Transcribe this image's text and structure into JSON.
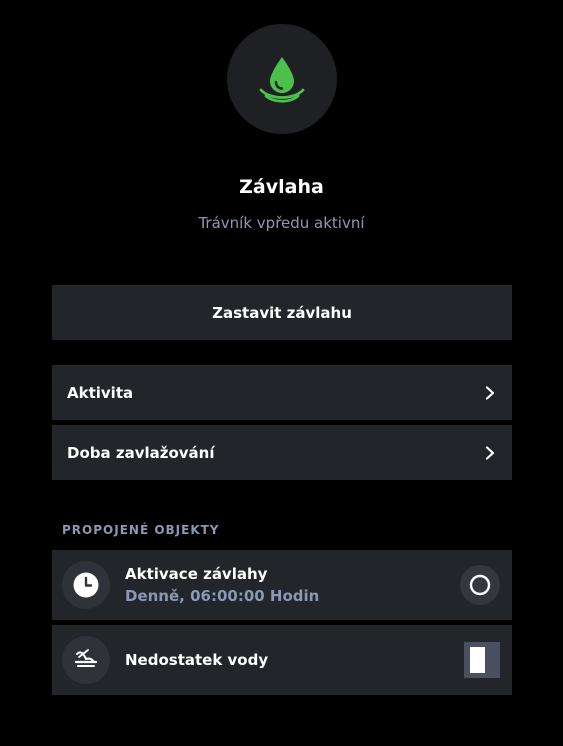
{
  "header": {
    "title": "Závlaha",
    "subtitle": "Trávník vpředu aktivní",
    "icon": "water-drop-icon",
    "accent_color": "#4cc04a"
  },
  "actions": {
    "stop_label": "Zastavit závlahu"
  },
  "menu": {
    "items": [
      {
        "label": "Aktivita",
        "icon": "chevron-right-icon"
      },
      {
        "label": "Doba zavlažování",
        "icon": "chevron-right-icon"
      }
    ]
  },
  "linked": {
    "section_title": "PROPOJENÉ OBJEKTY",
    "items": [
      {
        "name": "Aktivace závlahy",
        "detail": "Denně, 06:00:00 Hodin",
        "icon": "clock-icon",
        "control": "radio-icon"
      },
      {
        "name": "Nedostatek vody",
        "icon": "water-shortage-icon",
        "control": "toggle-switch"
      }
    ]
  }
}
